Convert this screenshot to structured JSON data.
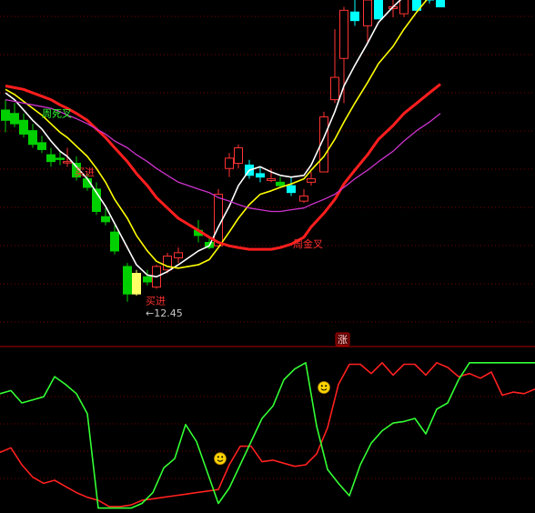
{
  "colors": {
    "background": "#000000",
    "grid": "#7a0000",
    "divider": "#b00000",
    "up": "#ff3333",
    "down_green": "#00d000",
    "down_cyan": "#00ffff",
    "highlight_candle": "#ffff66",
    "ma_fast": "#ffffff",
    "ma_mid": "#ffff00",
    "ma_slow": "#ff1e1e",
    "ma_long": "#cc33cc",
    "ind_red": "#ff2020",
    "ind_green": "#33ff33",
    "label_red": "#ff3030",
    "label_green": "#33ff33",
    "price_note": "#c8c8c8",
    "face": "#ffd400"
  },
  "labels": {
    "dead_cross": "周死叉",
    "golden_cross": "周金叉",
    "buy1": "买进",
    "buy2": "买进",
    "low_price": "←12.45",
    "rise_tag": "涨"
  },
  "chart_data": [
    {
      "type": "candlestick",
      "title": "",
      "ylim": [
        10,
        30
      ],
      "price_label": 12.45,
      "candles": [
        {
          "o": 23.6,
          "h": 24.2,
          "l": 22.3,
          "c": 23.0,
          "color": "green"
        },
        {
          "o": 23.4,
          "h": 24.0,
          "l": 22.6,
          "c": 22.8,
          "color": "green"
        },
        {
          "o": 23.0,
          "h": 23.4,
          "l": 22.0,
          "c": 22.2,
          "color": "green"
        },
        {
          "o": 22.4,
          "h": 22.8,
          "l": 21.4,
          "c": 21.6,
          "color": "green"
        },
        {
          "o": 21.7,
          "h": 22.1,
          "l": 21.1,
          "c": 21.3,
          "color": "green"
        },
        {
          "o": 21.0,
          "h": 21.4,
          "l": 20.3,
          "c": 20.6,
          "color": "green"
        },
        {
          "o": 20.8,
          "h": 21.2,
          "l": 20.4,
          "c": 20.8,
          "color": "green"
        },
        {
          "o": 20.6,
          "h": 21.4,
          "l": 20.3,
          "c": 20.6,
          "color": "red"
        },
        {
          "o": 20.5,
          "h": 20.9,
          "l": 19.5,
          "c": 19.7,
          "color": "green"
        },
        {
          "o": 19.6,
          "h": 19.9,
          "l": 18.9,
          "c": 19.1,
          "color": "green"
        },
        {
          "o": 19.0,
          "h": 19.4,
          "l": 17.5,
          "c": 17.7,
          "color": "green"
        },
        {
          "o": 17.4,
          "h": 17.9,
          "l": 16.9,
          "c": 17.1,
          "color": "green"
        },
        {
          "o": 16.5,
          "h": 16.9,
          "l": 15.2,
          "c": 15.4,
          "color": "green"
        },
        {
          "o": 14.5,
          "h": 14.7,
          "l": 12.45,
          "c": 12.9,
          "color": "green"
        },
        {
          "o": 12.9,
          "h": 14.3,
          "l": 12.8,
          "c": 14.1,
          "color": "yellow"
        },
        {
          "o": 13.6,
          "h": 14.3,
          "l": 13.4,
          "c": 13.9,
          "color": "green"
        },
        {
          "o": 13.3,
          "h": 14.6,
          "l": 13.2,
          "c": 14.5,
          "color": "red"
        },
        {
          "o": 14.3,
          "h": 15.3,
          "l": 14.1,
          "c": 15.1,
          "color": "red"
        },
        {
          "o": 15.0,
          "h": 15.6,
          "l": 14.7,
          "c": 15.3,
          "color": "red"
        },
        {
          "o": 16.6,
          "h": 17.2,
          "l": 15.9,
          "c": 16.3,
          "color": "green"
        },
        {
          "o": 15.9,
          "h": 16.2,
          "l": 15.5,
          "c": 15.6,
          "color": "green"
        },
        {
          "o": 15.7,
          "h": 19.0,
          "l": 15.6,
          "c": 18.7,
          "color": "red"
        },
        {
          "o": 20.2,
          "h": 21.1,
          "l": 19.7,
          "c": 20.8,
          "color": "red"
        },
        {
          "o": 20.5,
          "h": 21.6,
          "l": 20.2,
          "c": 21.4,
          "color": "red"
        },
        {
          "o": 20.4,
          "h": 20.7,
          "l": 19.6,
          "c": 19.8,
          "color": "cyan"
        },
        {
          "o": 19.9,
          "h": 20.3,
          "l": 19.4,
          "c": 19.7,
          "color": "cyan"
        },
        {
          "o": 19.6,
          "h": 20.2,
          "l": 19.4,
          "c": 19.5,
          "color": "red"
        },
        {
          "o": 19.4,
          "h": 19.7,
          "l": 19.1,
          "c": 19.2,
          "color": "green"
        },
        {
          "o": 18.8,
          "h": 19.7,
          "l": 18.6,
          "c": 19.2,
          "color": "cyan"
        },
        {
          "o": 18.3,
          "h": 19.0,
          "l": 18.2,
          "c": 18.6,
          "color": "red"
        },
        {
          "o": 19.6,
          "h": 20.0,
          "l": 19.2,
          "c": 19.4,
          "color": "red"
        },
        {
          "o": 20.0,
          "h": 23.5,
          "l": 20.0,
          "c": 23.2,
          "color": "red"
        },
        {
          "o": 24.2,
          "h": 28.3,
          "l": 24.0,
          "c": 25.5,
          "color": "red"
        },
        {
          "o": 26.6,
          "h": 29.6,
          "l": 24.0,
          "c": 29.4,
          "color": "red"
        },
        {
          "o": 29.3,
          "h": 30.5,
          "l": 28.5,
          "c": 28.8,
          "color": "cyan"
        },
        {
          "o": 28.5,
          "h": 30.2,
          "l": 27.5,
          "c": 30.0,
          "color": "red"
        },
        {
          "o": 30.0,
          "h": 31.5,
          "l": 29.0,
          "c": 28.9,
          "color": "cyan"
        },
        {
          "o": 29.5,
          "h": 30.3,
          "l": 29.0,
          "c": 29.6,
          "color": "red"
        },
        {
          "o": 29.2,
          "h": 30.6,
          "l": 29.0,
          "c": 30.4,
          "color": "red"
        },
        {
          "o": 30.0,
          "h": 30.5,
          "l": 29.3,
          "c": 29.4,
          "color": "cyan"
        },
        {
          "o": 30.2,
          "h": 30.6,
          "l": 29.8,
          "c": 30.0,
          "color": "cyan"
        },
        {
          "o": 30.5,
          "h": 31.0,
          "l": 29.6,
          "c": 29.6,
          "color": "cyan"
        }
      ],
      "candle_x": [
        6,
        16,
        26,
        36,
        46,
        56,
        66,
        74,
        84,
        96,
        106,
        116,
        126,
        140,
        150,
        162,
        172,
        184,
        196,
        218,
        230,
        240,
        252,
        262,
        274,
        286,
        298,
        308,
        320,
        334,
        342,
        356,
        368,
        378,
        390,
        404,
        416,
        432,
        444,
        458,
        472,
        484
      ],
      "series": [
        {
          "name": "",
          "color_key": "ma_fast",
          "values": [
            24.6,
            24.2,
            23.6,
            23.0,
            22.5,
            21.8,
            21.2,
            20.9,
            20.3,
            19.6,
            18.8,
            18.0,
            17.0,
            15.6,
            14.6,
            14.0,
            13.9,
            14.2,
            14.6,
            15.4,
            15.7,
            16.8,
            18.0,
            19.2,
            20.1,
            20.3,
            20.0,
            19.8,
            19.7,
            19.8,
            20.4,
            22.0,
            23.5,
            25.0,
            26.2,
            27.5,
            28.7,
            29.6,
            30.2,
            30.8,
            31.2,
            31.5
          ]
        },
        {
          "name": "",
          "color_key": "ma_mid",
          "values": [
            24.8,
            24.5,
            24.1,
            23.7,
            23.3,
            22.8,
            22.3,
            22.0,
            21.5,
            20.9,
            20.2,
            19.4,
            18.4,
            17.3,
            16.3,
            15.4,
            14.8,
            14.5,
            14.4,
            14.6,
            14.9,
            15.6,
            16.5,
            17.3,
            18.1,
            18.7,
            18.9,
            19.1,
            19.3,
            19.6,
            20.1,
            20.9,
            21.9,
            22.9,
            24.0,
            25.2,
            26.3,
            27.3,
            28.3,
            29.3,
            30.2,
            31.0
          ]
        },
        {
          "name": "",
          "color_key": "ma_slow",
          "values": [
            25.0,
            24.9,
            24.8,
            24.6,
            24.4,
            24.2,
            23.9,
            23.7,
            23.4,
            23.0,
            22.5,
            22.0,
            21.4,
            20.6,
            19.9,
            19.2,
            18.5,
            17.9,
            17.3,
            16.6,
            16.2,
            15.9,
            15.7,
            15.6,
            15.5,
            15.5,
            15.5,
            15.6,
            15.8,
            16.2,
            16.8,
            17.6,
            18.4,
            19.3,
            20.1,
            21.0,
            21.9,
            22.7,
            23.4,
            24.0,
            24.6,
            25.1
          ]
        },
        {
          "name": "",
          "color_key": "ma_long",
          "values": [
            24.2,
            24.1,
            24.0,
            23.9,
            23.8,
            23.7,
            23.5,
            23.3,
            23.1,
            22.8,
            22.5,
            22.2,
            21.8,
            21.4,
            21.0,
            20.6,
            20.2,
            19.8,
            19.4,
            19.0,
            18.8,
            18.5,
            18.3,
            18.1,
            17.9,
            17.8,
            17.7,
            17.7,
            17.8,
            17.9,
            18.1,
            18.4,
            18.7,
            19.1,
            19.6,
            20.1,
            20.6,
            21.2,
            21.8,
            22.4,
            22.9,
            23.4
          ]
        }
      ],
      "series_x": [
        6,
        16,
        26,
        36,
        46,
        56,
        66,
        74,
        84,
        96,
        106,
        116,
        126,
        140,
        150,
        162,
        172,
        184,
        196,
        218,
        230,
        240,
        252,
        262,
        274,
        286,
        298,
        308,
        320,
        334,
        342,
        356,
        368,
        378,
        390,
        404,
        416,
        432,
        444,
        458,
        472,
        484
      ],
      "annotations": [
        {
          "text_key": "dead_cross",
          "data_x": 46,
          "data_y": 23.2,
          "color_key": "label_green"
        },
        {
          "text_key": "golden_cross",
          "data_x": 322,
          "data_y": 15.6,
          "color_key": "label_red"
        },
        {
          "text_key": "buy1",
          "data_x": 82,
          "data_y": 19.8,
          "color_key": "label_red"
        },
        {
          "text_key": "buy2",
          "data_x": 160,
          "data_y": 12.3,
          "color_key": "label_red"
        },
        {
          "text_key": "low_price",
          "data_x": 160,
          "data_y": 11.6,
          "color_key": "price_note"
        }
      ]
    },
    {
      "type": "line",
      "title": "",
      "ylim": [
        0,
        100
      ],
      "series": [
        {
          "name": "",
          "color_key": "ind_red",
          "x": [
            0,
            12,
            24,
            36,
            48,
            60,
            72,
            84,
            96,
            108,
            120,
            132,
            144,
            156,
            168,
            180,
            192,
            204,
            216,
            228,
            240,
            252,
            264,
            276,
            288,
            300,
            312,
            324,
            336,
            348,
            360,
            372,
            384,
            396,
            408,
            420,
            432,
            444,
            456,
            468,
            480,
            492,
            504,
            516,
            528,
            540,
            552,
            564,
            576,
            588
          ],
          "values": [
            38,
            41,
            30,
            22,
            18,
            20,
            16,
            12,
            9,
            7,
            3,
            3,
            4,
            7,
            8,
            9,
            10,
            11,
            12,
            13,
            14,
            30,
            42,
            42,
            32,
            33,
            31,
            29,
            30,
            37,
            54,
            82,
            95,
            95,
            89,
            96,
            88,
            95,
            95,
            88,
            96,
            93,
            87,
            89,
            86,
            90,
            75,
            77,
            76,
            79
          ]
        },
        {
          "name": "",
          "color_key": "ind_green",
          "x": [
            0,
            12,
            24,
            36,
            48,
            60,
            72,
            84,
            96,
            108,
            120,
            132,
            144,
            156,
            168,
            180,
            192,
            204,
            216,
            228,
            240,
            252,
            264,
            276,
            288,
            300,
            312,
            324,
            336,
            348,
            360,
            372,
            384,
            396,
            408,
            420,
            432,
            444,
            456,
            468,
            480,
            492,
            504,
            516,
            528,
            540,
            552,
            564,
            576,
            588
          ],
          "values": [
            76,
            78,
            70,
            72,
            74,
            87,
            82,
            76,
            63,
            2,
            2,
            2,
            2,
            5,
            12,
            28,
            34,
            56,
            45,
            25,
            5,
            15,
            30,
            45,
            60,
            68,
            85,
            92,
            96,
            55,
            27,
            18,
            10,
            30,
            44,
            52,
            57,
            58,
            60,
            50,
            66,
            70,
            85,
            96,
            96,
            96,
            96,
            96,
            96,
            96
          ]
        }
      ],
      "annotations": [
        {
          "type": "smiley",
          "data_x": 242,
          "data_y": 34
        },
        {
          "type": "smiley",
          "data_x": 356,
          "data_y": 80
        }
      ]
    }
  ]
}
